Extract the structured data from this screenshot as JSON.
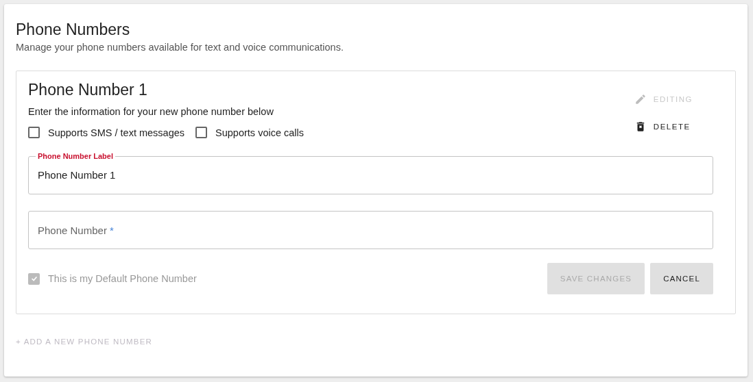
{
  "header": {
    "title": "Phone Numbers",
    "subtitle": "Manage your phone numbers available for text and voice communications."
  },
  "phone_card": {
    "title": "Phone Number 1",
    "instructions": "Enter the information for your new phone number below",
    "actions": [
      {
        "kind": "edit",
        "label": "EDITING",
        "disabled": true
      },
      {
        "kind": "delete",
        "label": "DELETE",
        "disabled": false
      }
    ],
    "options": [
      {
        "label": "Supports SMS / text messages",
        "checked": false
      },
      {
        "label": "Supports voice calls",
        "checked": false
      }
    ],
    "fields": [
      {
        "label": "Phone Number Label",
        "value": "Phone Number 1",
        "focused": true
      },
      {
        "label": "Phone Number",
        "required_mark": "*"
      }
    ],
    "default_option": {
      "label": "This is my Default Phone Number",
      "checked": true,
      "disabled": true
    },
    "buttons": [
      {
        "label": "SAVE CHANGES",
        "disabled": true
      },
      {
        "label": "CANCEL",
        "disabled": false
      }
    ]
  },
  "add_link": {
    "label": "+ ADD A NEW PHONE NUMBER",
    "disabled": true
  }
}
